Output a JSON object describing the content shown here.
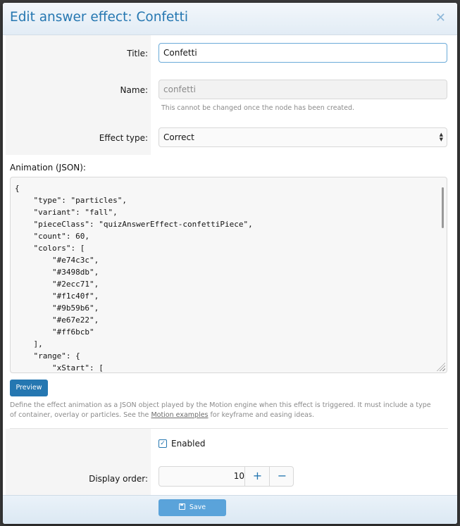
{
  "dialog": {
    "title": "Edit answer effect: Confetti",
    "close_glyph": "✕"
  },
  "form": {
    "title_label": "Title:",
    "title_value": "Confetti",
    "name_label": "Name:",
    "name_value": "confetti",
    "name_hint": "This cannot be changed once the node has been created.",
    "effect_type_label": "Effect type:",
    "effect_type_value": "Correct",
    "animation_label": "Animation (JSON):",
    "animation_lines": [
      "{",
      "    \"type\": \"particles\",",
      "    \"variant\": \"fall\",",
      "    \"pieceClass\": \"quizAnswerEffect-confettiPiece\",",
      "    \"count\": 60,",
      "    \"colors\": [",
      "        \"#e74c3c\",",
      "        \"#3498db\",",
      "        \"#2ecc71\",",
      "        \"#f1c40f\",",
      "        \"#9b59b6\",",
      "        \"#e67e22\",",
      "        \"#ff6bcb\"",
      "    ],",
      "    \"range\": {",
      "        \"xStart\": ["
    ],
    "preview_label": "Preview",
    "explain_before": "Define the effect animation as a JSON object played by the Motion engine when this effect is triggered. It must include a type of container, overlay or particles. See the ",
    "explain_link": "Motion examples",
    "explain_after": " for keyframe and easing ideas.",
    "enabled_label": "Enabled",
    "enabled_checked": true,
    "display_order_label": "Display order:",
    "display_order_value": "10",
    "increment_glyph": "+",
    "decrement_glyph": "−"
  },
  "footer": {
    "save_label": "Save"
  },
  "colors": {
    "accent": "#2577b1",
    "save_button": "#5aa3da"
  },
  "icons": {
    "close": "close-icon",
    "select": "select-arrows-icon",
    "checkbox": "check-icon",
    "save": "save-icon"
  }
}
